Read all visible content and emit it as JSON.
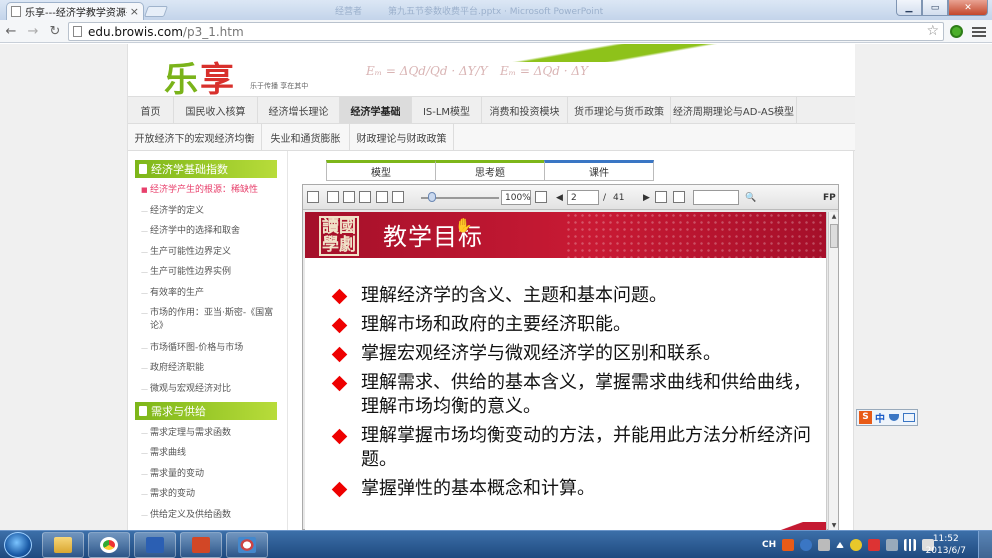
{
  "browser": {
    "tab_title": "乐享---经济学教学资源平台",
    "url_host": "edu.browis.com",
    "url_path": "/p3_1.htm",
    "close_glyph": "×",
    "back_glyph": "←",
    "forward_glyph": "→",
    "reload_glyph": "↻",
    "star_glyph": "☆",
    "bg_tab_ghost_1": "经营者",
    "bg_tab_ghost_2": "第九五节参数收费平台.pptx · Microsoft PowerPoint",
    "win_min": "▁",
    "win_max": "▭",
    "win_close": "✕"
  },
  "site": {
    "logo_text_1": "乐",
    "logo_text_2": "享",
    "slogan": "乐于传播 享在其中",
    "formula_1": "Eₘ = ΔQd/Qd · ΔY/Y",
    "formula_2": "Eₘ = ΔQd · ΔY",
    "main_nav": [
      {
        "label": "首页"
      },
      {
        "label": "国民收入核算"
      },
      {
        "label": "经济增长理论"
      },
      {
        "label": "经济学基础"
      },
      {
        "label": "IS-LM模型"
      },
      {
        "label": "消费和投资模块"
      },
      {
        "label": "货币理论与货币政策"
      },
      {
        "label": "经济周期理论与AD-AS模型"
      }
    ],
    "active_main_nav": "经济学基础",
    "sub_nav": [
      {
        "label": "开放经济下的宏观经济均衡"
      },
      {
        "label": "失业和通货膨胀"
      },
      {
        "label": "财政理论与财政政策"
      }
    ]
  },
  "sidebar": {
    "section_1": {
      "title": "经济学基础指数",
      "items": [
        {
          "label": "经济学产生的根源：稀缺性"
        },
        {
          "label": "经济学的定义"
        },
        {
          "label": "经济学中的选择和取舍"
        },
        {
          "label": "生产可能性边界定义"
        },
        {
          "label": "生产可能性边界实例"
        },
        {
          "label": "有效率的生产"
        },
        {
          "label": "市场的作用：亚当·斯密-《国富论》"
        },
        {
          "label": "市场循环图-价格与市场"
        },
        {
          "label": "政府经济职能"
        },
        {
          "label": "微观与宏观经济对比"
        }
      ]
    },
    "section_2": {
      "title": "需求与供给",
      "items": [
        {
          "label": "需求定理与需求函数"
        },
        {
          "label": "需求曲线"
        },
        {
          "label": "需求量的变动"
        },
        {
          "label": "需求的变动"
        },
        {
          "label": "供给定义及供给函数"
        }
      ]
    }
  },
  "content": {
    "tabs": [
      {
        "label": "模型"
      },
      {
        "label": "思考题"
      },
      {
        "label": "课件"
      }
    ],
    "active_tab": "课件",
    "viewer": {
      "zoom": "100%",
      "page_current": "2",
      "page_separator": "/",
      "page_total": "41",
      "fp_label": "FP",
      "search_value": "",
      "search_glyph": "🔍",
      "prev_glyph": "◀",
      "next_glyph": "▶",
      "scroll_up": "▲",
      "scroll_down": "▼"
    },
    "slide": {
      "seal_chars": [
        "讀",
        "國",
        "學",
        "劇"
      ],
      "title": "教学目标",
      "bullets": [
        {
          "text": "理解经济学的含义、主题和基本问题。"
        },
        {
          "text": "理解市场和政府的主要经济职能。"
        },
        {
          "text": "掌握宏观经济学与微观经济学的区别和联系。"
        },
        {
          "text": "理解需求、供给的基本含义，掌握需求曲线和供给曲线，理解市场均衡的意义。"
        },
        {
          "text": "理解掌握市场均衡变动的方法，并能用此方法分析经济问题。"
        },
        {
          "text": "掌握弹性的基本概念和计算。"
        }
      ]
    }
  },
  "ime": {
    "s": "S",
    "lang": "中"
  },
  "taskbar": {
    "lang": "CH",
    "time": "11:52",
    "date": "2013/6/7"
  },
  "colors": {
    "accent_green": "#7db619",
    "accent_red": "#c91a34",
    "active_link": "#e8406c"
  }
}
